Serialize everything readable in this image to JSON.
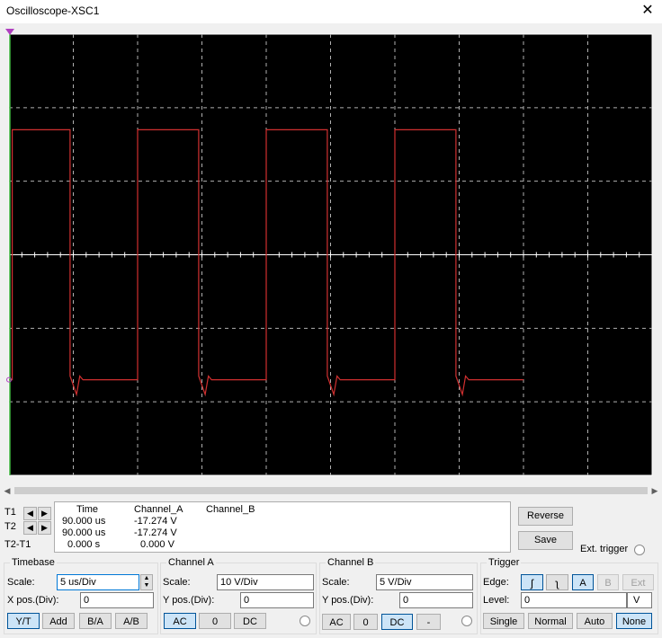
{
  "window": {
    "title": "Oscilloscope-XSC1",
    "close_glyph": "✕"
  },
  "screen": {
    "background": "#000000",
    "grid_color": "#b0b0b0",
    "trace_color": "#d03030",
    "divisions_x": 10,
    "divisions_y": 6
  },
  "chart_data": {
    "type": "line",
    "title": "",
    "xlabel": "",
    "ylabel": "",
    "x_units": "div",
    "y_units": "div",
    "xlim": [
      0,
      10
    ],
    "ylim": [
      -3,
      3
    ],
    "series": [
      {
        "color": "#d03030",
        "x": [
          0.0,
          0.05,
          0.05,
          0.95,
          0.95,
          1.05,
          1.1,
          1.15,
          2.0,
          2.0,
          2.95,
          2.95,
          3.05,
          3.1,
          3.15,
          4.0,
          4.0,
          4.95,
          4.95,
          5.05,
          5.1,
          5.15,
          6.0,
          6.0,
          6.95,
          6.95,
          7.05,
          7.1,
          7.15,
          8.0
        ],
        "y": [
          -1.7,
          -1.7,
          1.7,
          1.7,
          -1.65,
          -1.9,
          -1.65,
          -1.7,
          -1.7,
          1.7,
          1.7,
          -1.65,
          -1.9,
          -1.65,
          -1.7,
          -1.7,
          1.7,
          1.7,
          -1.65,
          -1.9,
          -1.65,
          -1.7,
          -1.7,
          1.7,
          1.7,
          -1.65,
          -1.9,
          -1.65,
          -1.7,
          -1.7
        ]
      }
    ],
    "cursor_t1_color": "#3cb43c"
  },
  "readout": {
    "t1": "T1",
    "t2": "T2",
    "t2t1": "T2-T1",
    "headers": [
      "Time",
      "Channel_A",
      "Channel_B"
    ],
    "rows": [
      [
        "90.000 us",
        "-17.274 V",
        ""
      ],
      [
        "90.000 us",
        "-17.274 V",
        ""
      ],
      [
        "0.000 s",
        "0.000 V",
        ""
      ]
    ],
    "reverse": "Reverse",
    "save": "Save",
    "ext_trigger": "Ext. trigger"
  },
  "timebase": {
    "label": "Timebase",
    "scale_label": "Scale:",
    "scale_value": "5 us/Div",
    "xpos_label": "X pos.(Div):",
    "xpos_value": "0",
    "buttons": [
      "Y/T",
      "Add",
      "B/A",
      "A/B"
    ]
  },
  "channel_a": {
    "label": "Channel A",
    "scale_label": "Scale:",
    "scale_value": "10  V/Div",
    "ypos_label": "Y pos.(Div):",
    "ypos_value": "0",
    "buttons": [
      "AC",
      "0",
      "DC"
    ]
  },
  "channel_b": {
    "label": "Channel B",
    "scale_label": "Scale:",
    "scale_value": "5  V/Div",
    "ypos_label": "Y pos.(Div):",
    "ypos_value": "0",
    "buttons": [
      "AC",
      "0",
      "DC",
      "-"
    ]
  },
  "trigger": {
    "label": "Trigger",
    "edge_label": "Edge:",
    "level_label": "Level:",
    "level_value": "0",
    "level_unit": "V",
    "edge_buttons": [
      "A",
      "B",
      "Ext"
    ],
    "mode_buttons": [
      "Single",
      "Normal",
      "Auto",
      "None"
    ]
  }
}
